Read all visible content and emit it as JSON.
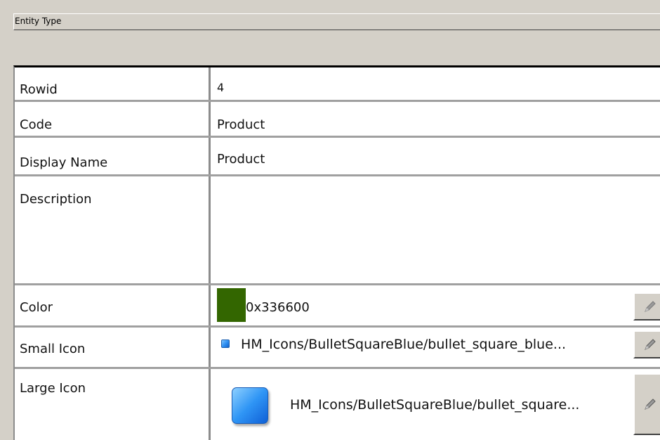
{
  "panel": {
    "title": "Entity Type"
  },
  "fields": [
    {
      "label": "Rowid",
      "value": "4"
    },
    {
      "label": "Code",
      "value": "Product"
    },
    {
      "label": "Display Name",
      "value": "Product"
    },
    {
      "label": "Description",
      "value": ""
    },
    {
      "label": "Color",
      "value": "0x336600",
      "swatch_color": "#336600",
      "edit_icon": "pencil-icon"
    },
    {
      "label": "Small Icon",
      "value": "HM_Icons/BulletSquareBlue/bullet_square_blue...",
      "icon": "bullet-square-blue-icon",
      "edit_icon": "pencil-icon"
    },
    {
      "label": "Large Icon",
      "value": "HM_Icons/BulletSquareBlue/bullet_square...",
      "icon": "bullet-square-blue-icon",
      "edit_icon": "pencil-icon"
    }
  ]
}
